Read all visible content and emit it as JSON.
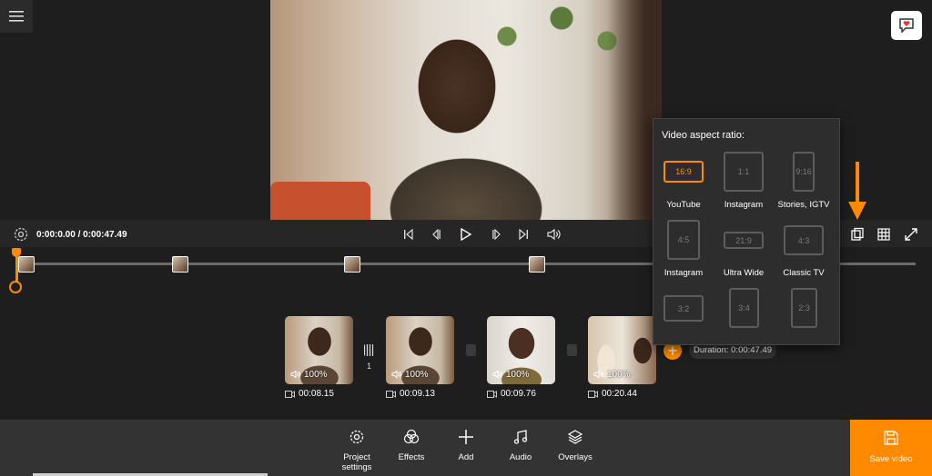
{
  "player": {
    "time": "0:00:0.00 / 0:00:47.49"
  },
  "clips": [
    {
      "volume": "100%",
      "duration": "00:08.15"
    },
    {
      "volume": "100%",
      "duration": "00:09.13"
    },
    {
      "volume": "100%",
      "duration": "00:09.76"
    },
    {
      "volume": "100%",
      "duration": "00:20.44"
    }
  ],
  "transition_count": "1",
  "total_duration": "Duration: 0:00:47.49",
  "aspect_popup": {
    "title": "Video aspect ratio:",
    "options": [
      {
        "ratio": "16:9",
        "label": "YouTube",
        "selected": true
      },
      {
        "ratio": "1:1",
        "label": "Instagram"
      },
      {
        "ratio": "9:16",
        "label": "Stories, IGTV"
      },
      {
        "ratio": "4:5",
        "label": "Instagram"
      },
      {
        "ratio": "21:9",
        "label": "Ultra Wide"
      },
      {
        "ratio": "4:3",
        "label": "Classic TV"
      },
      {
        "ratio": "3:2",
        "label": ""
      },
      {
        "ratio": "3:4",
        "label": ""
      },
      {
        "ratio": "2:3",
        "label": ""
      }
    ]
  },
  "toolbar": {
    "project_settings": "Project settings",
    "effects": "Effects",
    "add": "Add",
    "audio": "Audio",
    "overlays": "Overlays",
    "save": "Save video"
  },
  "colors": {
    "accent": "#ff8a00",
    "background": "#1e1e1e",
    "toolbar": "#333333"
  }
}
